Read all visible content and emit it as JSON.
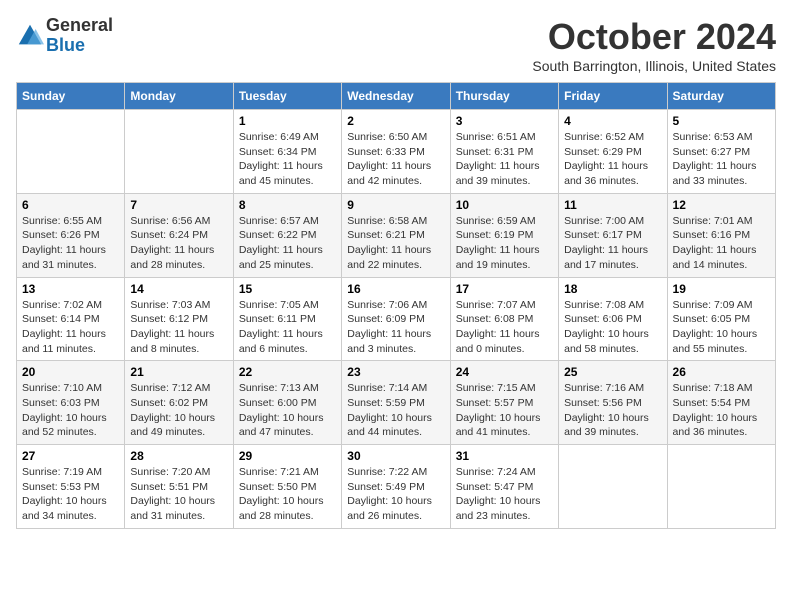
{
  "logo": {
    "general": "General",
    "blue": "Blue"
  },
  "title": "October 2024",
  "location": "South Barrington, Illinois, United States",
  "days_of_week": [
    "Sunday",
    "Monday",
    "Tuesday",
    "Wednesday",
    "Thursday",
    "Friday",
    "Saturday"
  ],
  "weeks": [
    [
      {
        "day": "",
        "info": ""
      },
      {
        "day": "",
        "info": ""
      },
      {
        "day": "1",
        "info": "Sunrise: 6:49 AM\nSunset: 6:34 PM\nDaylight: 11 hours and 45 minutes."
      },
      {
        "day": "2",
        "info": "Sunrise: 6:50 AM\nSunset: 6:33 PM\nDaylight: 11 hours and 42 minutes."
      },
      {
        "day": "3",
        "info": "Sunrise: 6:51 AM\nSunset: 6:31 PM\nDaylight: 11 hours and 39 minutes."
      },
      {
        "day": "4",
        "info": "Sunrise: 6:52 AM\nSunset: 6:29 PM\nDaylight: 11 hours and 36 minutes."
      },
      {
        "day": "5",
        "info": "Sunrise: 6:53 AM\nSunset: 6:27 PM\nDaylight: 11 hours and 33 minutes."
      }
    ],
    [
      {
        "day": "6",
        "info": "Sunrise: 6:55 AM\nSunset: 6:26 PM\nDaylight: 11 hours and 31 minutes."
      },
      {
        "day": "7",
        "info": "Sunrise: 6:56 AM\nSunset: 6:24 PM\nDaylight: 11 hours and 28 minutes."
      },
      {
        "day": "8",
        "info": "Sunrise: 6:57 AM\nSunset: 6:22 PM\nDaylight: 11 hours and 25 minutes."
      },
      {
        "day": "9",
        "info": "Sunrise: 6:58 AM\nSunset: 6:21 PM\nDaylight: 11 hours and 22 minutes."
      },
      {
        "day": "10",
        "info": "Sunrise: 6:59 AM\nSunset: 6:19 PM\nDaylight: 11 hours and 19 minutes."
      },
      {
        "day": "11",
        "info": "Sunrise: 7:00 AM\nSunset: 6:17 PM\nDaylight: 11 hours and 17 minutes."
      },
      {
        "day": "12",
        "info": "Sunrise: 7:01 AM\nSunset: 6:16 PM\nDaylight: 11 hours and 14 minutes."
      }
    ],
    [
      {
        "day": "13",
        "info": "Sunrise: 7:02 AM\nSunset: 6:14 PM\nDaylight: 11 hours and 11 minutes."
      },
      {
        "day": "14",
        "info": "Sunrise: 7:03 AM\nSunset: 6:12 PM\nDaylight: 11 hours and 8 minutes."
      },
      {
        "day": "15",
        "info": "Sunrise: 7:05 AM\nSunset: 6:11 PM\nDaylight: 11 hours and 6 minutes."
      },
      {
        "day": "16",
        "info": "Sunrise: 7:06 AM\nSunset: 6:09 PM\nDaylight: 11 hours and 3 minutes."
      },
      {
        "day": "17",
        "info": "Sunrise: 7:07 AM\nSunset: 6:08 PM\nDaylight: 11 hours and 0 minutes."
      },
      {
        "day": "18",
        "info": "Sunrise: 7:08 AM\nSunset: 6:06 PM\nDaylight: 10 hours and 58 minutes."
      },
      {
        "day": "19",
        "info": "Sunrise: 7:09 AM\nSunset: 6:05 PM\nDaylight: 10 hours and 55 minutes."
      }
    ],
    [
      {
        "day": "20",
        "info": "Sunrise: 7:10 AM\nSunset: 6:03 PM\nDaylight: 10 hours and 52 minutes."
      },
      {
        "day": "21",
        "info": "Sunrise: 7:12 AM\nSunset: 6:02 PM\nDaylight: 10 hours and 49 minutes."
      },
      {
        "day": "22",
        "info": "Sunrise: 7:13 AM\nSunset: 6:00 PM\nDaylight: 10 hours and 47 minutes."
      },
      {
        "day": "23",
        "info": "Sunrise: 7:14 AM\nSunset: 5:59 PM\nDaylight: 10 hours and 44 minutes."
      },
      {
        "day": "24",
        "info": "Sunrise: 7:15 AM\nSunset: 5:57 PM\nDaylight: 10 hours and 41 minutes."
      },
      {
        "day": "25",
        "info": "Sunrise: 7:16 AM\nSunset: 5:56 PM\nDaylight: 10 hours and 39 minutes."
      },
      {
        "day": "26",
        "info": "Sunrise: 7:18 AM\nSunset: 5:54 PM\nDaylight: 10 hours and 36 minutes."
      }
    ],
    [
      {
        "day": "27",
        "info": "Sunrise: 7:19 AM\nSunset: 5:53 PM\nDaylight: 10 hours and 34 minutes."
      },
      {
        "day": "28",
        "info": "Sunrise: 7:20 AM\nSunset: 5:51 PM\nDaylight: 10 hours and 31 minutes."
      },
      {
        "day": "29",
        "info": "Sunrise: 7:21 AM\nSunset: 5:50 PM\nDaylight: 10 hours and 28 minutes."
      },
      {
        "day": "30",
        "info": "Sunrise: 7:22 AM\nSunset: 5:49 PM\nDaylight: 10 hours and 26 minutes."
      },
      {
        "day": "31",
        "info": "Sunrise: 7:24 AM\nSunset: 5:47 PM\nDaylight: 10 hours and 23 minutes."
      },
      {
        "day": "",
        "info": ""
      },
      {
        "day": "",
        "info": ""
      }
    ]
  ]
}
